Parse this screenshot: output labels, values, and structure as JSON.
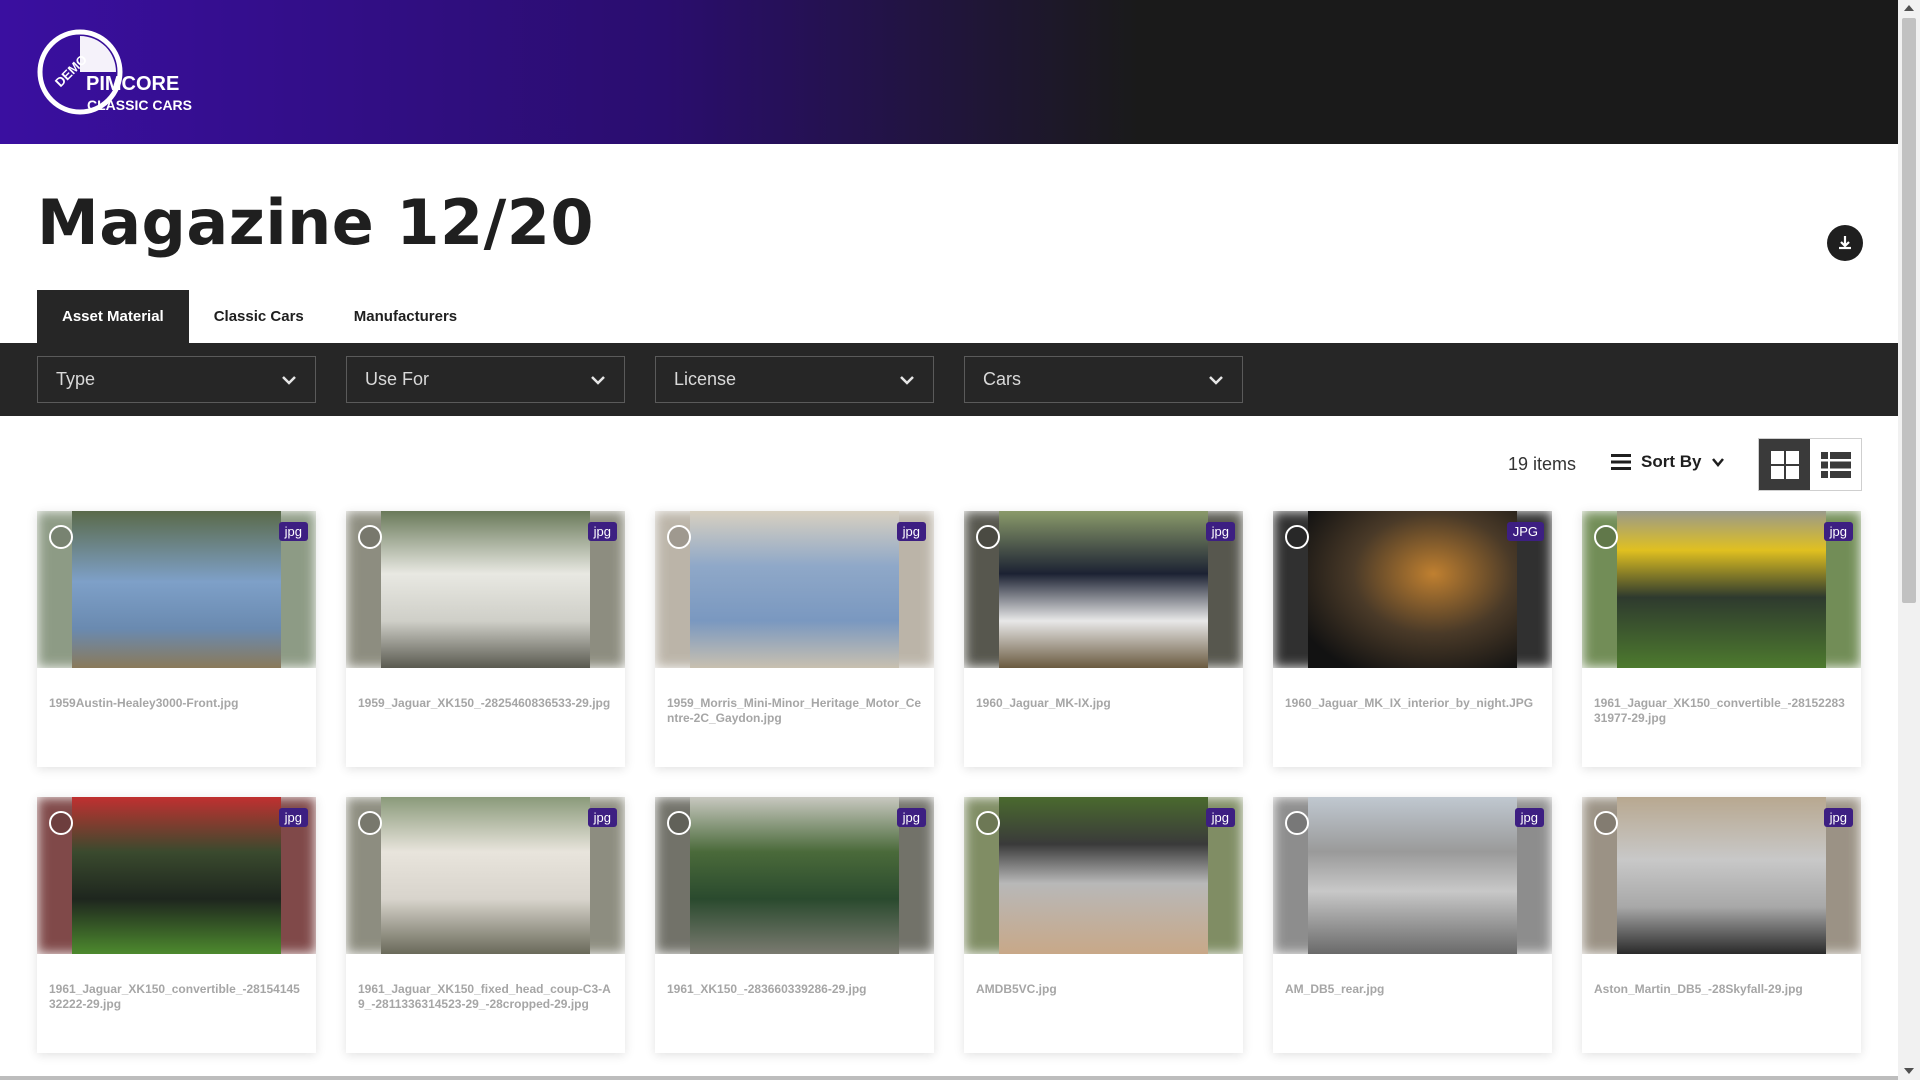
{
  "brand": {
    "logo_top": "DEMO",
    "logo_name": "PIMCORE",
    "logo_sub": "CLASSIC CARS",
    "accent": "#3d1f82"
  },
  "page": {
    "title": "Magazine 12/20"
  },
  "tabs": [
    {
      "label": "Asset Material",
      "active": true
    },
    {
      "label": "Classic Cars",
      "active": false
    },
    {
      "label": "Manufacturers",
      "active": false
    }
  ],
  "filters": [
    {
      "label": "Type"
    },
    {
      "label": "Use For"
    },
    {
      "label": "License"
    },
    {
      "label": "Cars"
    }
  ],
  "toolbar": {
    "count": "19 items",
    "sort_label": "Sort By",
    "view_mode": "grid"
  },
  "assets": [
    {
      "name": "1959Austin-Healey3000-Front.jpg",
      "ext": "jpg",
      "color": "#7ea0c8"
    },
    {
      "name": "1959_Jaguar_XK150_-2825460836533-29.jpg",
      "ext": "jpg",
      "color": "#cfcfc8"
    },
    {
      "name": "1959_Morris_Mini-Minor_Heritage_Motor_Centre-2C_Gaydon.jpg",
      "ext": "jpg",
      "color": "#8fa8c8"
    },
    {
      "name": "1960_Jaguar_MK-IX.jpg",
      "ext": "jpg",
      "color": "#1c2233"
    },
    {
      "name": "1960_Jaguar_MK_IX_interior_by_night.JPG",
      "ext": "JPG",
      "color": "#2a2218"
    },
    {
      "name": "1961_Jaguar_XK150_convertible_-2815228331977-29.jpg",
      "ext": "jpg",
      "color": "#4d7a2e"
    },
    {
      "name": "1961_Jaguar_XK150_convertible_-2815414532222-29.jpg",
      "ext": "jpg",
      "color": "#3a4a2e"
    },
    {
      "name": "1961_Jaguar_XK150_fixed_head_coup-C3-A9_-2811336314523-29_-28cropped-29.jpg",
      "ext": "jpg",
      "color": "#9a9a88"
    },
    {
      "name": "1961_XK150_-283660339286-29.jpg",
      "ext": "jpg",
      "color": "#3d5a3a"
    },
    {
      "name": "AMDB5VC.jpg",
      "ext": "jpg",
      "color": "#9a9a8a"
    },
    {
      "name": "AM_DB5_rear.jpg",
      "ext": "jpg",
      "color": "#8a8a8a"
    },
    {
      "name": "Aston_Martin_DB5_-28Skyfall-29.jpg",
      "ext": "jpg",
      "color": "#9d9d9d"
    }
  ]
}
